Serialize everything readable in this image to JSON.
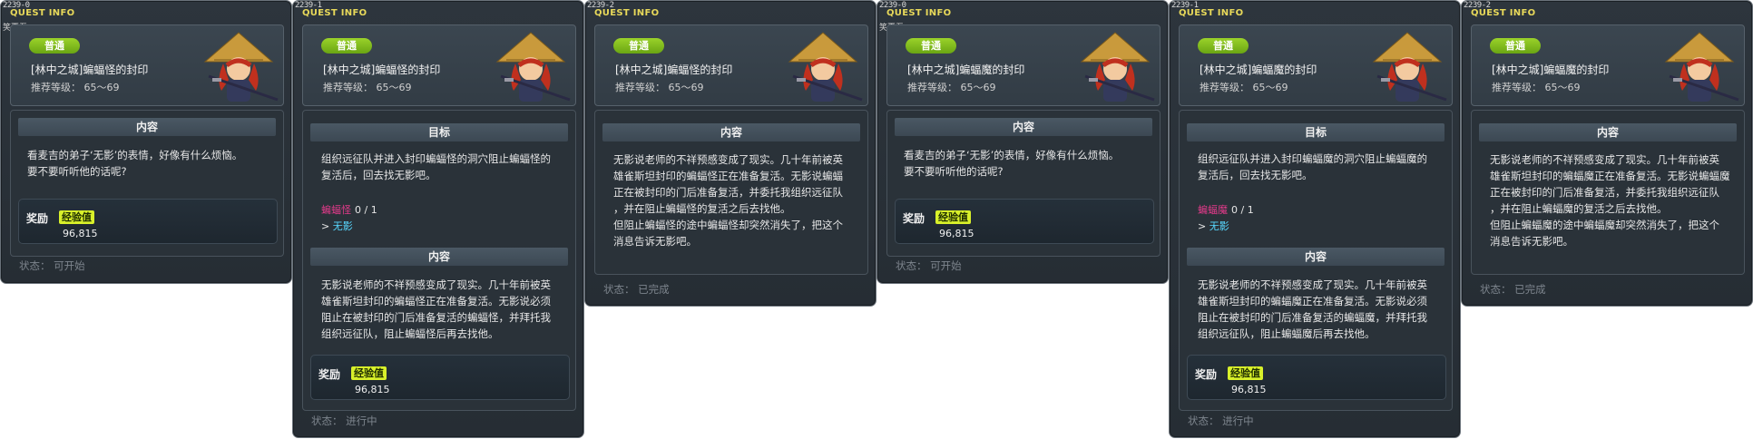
{
  "panels": [
    {
      "id": "2239-0",
      "header": "QUEST INFO",
      "sub": "笑夏吾",
      "badge": "普通",
      "title": "[林中之城]蝙蝠怪的封印",
      "level": "推荐等级： 65～69",
      "content_head": "内容",
      "content": "看麦吉的弟子‘无影’的表情，好像有什么烦恼。\n要不要听听他的话呢?",
      "reward_label": "奖励",
      "reward_type": "经验值",
      "reward_amount": "96,815",
      "status": "状态： 可开始"
    },
    {
      "id": "2239-1",
      "header": "QUEST INFO",
      "badge": "普通",
      "title": "[林中之城]蝙蝠怪的封印",
      "level": "推荐等级： 65～69",
      "goal_head": "目标",
      "goal": "组织远征队并进入封印蝙蝠怪的洞穴阻止蝙蝠怪的\n复活后，回去找无影吧。",
      "mob": "蝙蝠怪",
      "mob_count": "0 / 1",
      "npc_prefix": "> ",
      "npc": "无影",
      "content_head": "内容",
      "content": "无影说老师的不祥预感变成了现实。几十年前被英\n雄雀斯坦封印的蝙蝠怪正在准备复活。无影说必须\n阻止在被封印的门后准备复活的蝙蝠怪，并拜托我\n组织远征队，阻止蝙蝠怪后再去找他。",
      "reward_label": "奖励",
      "reward_type": "经验值",
      "reward_amount": "96,815",
      "status": "状态： 进行中"
    },
    {
      "id": "2239-2",
      "header": "QUEST INFO",
      "badge": "普通",
      "title": "[林中之城]蝙蝠怪的封印",
      "level": "推荐等级： 65～69",
      "content_head": "内容",
      "content": "无影说老师的不祥预感变成了现实。几十年前被英\n雄雀斯坦封印的蝙蝠怪正在准备复活。无影说蝙蝠\n正在被封印的门后准备复活，并委托我组织远征队\n，并在阻止蝙蝠怪的复活之后去找他。\n但阻止蝙蝠怪的途中蝙蝠怪却突然消失了，把这个\n消息告诉无影吧。",
      "status": "状态： 已完成"
    },
    {
      "id": "2239-0",
      "header": "QUEST INFO",
      "sub": "笑夏吾",
      "badge": "普通",
      "title": "[林中之城]蝙蝠魔的封印",
      "level": "推荐等级： 65～69",
      "content_head": "内容",
      "content": "看麦吉的弟子‘无影’的表情，好像有什么烦恼。\n要不要听听他的话呢?",
      "reward_label": "奖励",
      "reward_type": "经验值",
      "reward_amount": "96,815",
      "status": "状态： 可开始"
    },
    {
      "id": "2239-1",
      "header": "QUEST INFO",
      "badge": "普通",
      "title": "[林中之城]蝙蝠魔的封印",
      "level": "推荐等级： 65～69",
      "goal_head": "目标",
      "goal": "组织远征队并进入封印蝙蝠魔的洞穴阻止蝙蝠魔的\n复活后，回去找无影吧。",
      "mob": "蝙蝠魔",
      "mob_count": "0 / 1",
      "npc_prefix": "> ",
      "npc": "无影",
      "content_head": "内容",
      "content": "无影说老师的不祥预感变成了现实。几十年前被英\n雄雀斯坦封印的蝙蝠魔正在准备复活。无影说必须\n阻止在被封印的门后准备复活的蝙蝠魔，并拜托我\n组织远征队，阻止蝙蝠魔后再去找他。",
      "reward_label": "奖励",
      "reward_type": "经验值",
      "reward_amount": "96,815",
      "status": "状态： 进行中"
    },
    {
      "id": "2239-2",
      "header": "QUEST INFO",
      "badge": "普通",
      "title": "[林中之城]蝙蝠魔的封印",
      "level": "推荐等级： 65～69",
      "content_head": "内容",
      "content": "无影说老师的不祥预感变成了现实。几十年前被英\n雄雀斯坦封印的蝙蝠魔正在准备复活。无影说蝙蝠魔\n正在被封印的门后准备复活，并委托我组织远征队\n，并在阻止蝙蝠魔的复活之后去找他。\n但阻止蝙蝠魔的途中蝙蝠魔却突然消失了，把这个\n消息告诉无影吧。",
      "status": "状态： 已完成"
    }
  ],
  "colors": {
    "panel_bg": "#2b333a",
    "header_yellow": "#e8d95a",
    "badge_green": "#7fbf1e",
    "mob_pink": "#e23a8a",
    "npc_cyan": "#58d8ff",
    "exp_yellow": "#d8f02a",
    "status_gray": "#7d858d"
  },
  "icons": {
    "npc": "npc-portrait-straw-hat-icon"
  }
}
